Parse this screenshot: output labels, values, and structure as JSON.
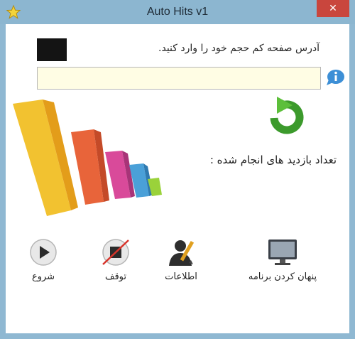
{
  "window": {
    "title": "Auto Hits v1",
    "close_label": "✕"
  },
  "form": {
    "url_label": "آدرس صفحه کم حجم خود را وارد کنید.",
    "url_value": "",
    "visits_label": "تعداد بازدید های انجام شده :"
  },
  "actions": {
    "start": "شروع",
    "stop": "توقف",
    "info": "اطلاعات",
    "hide": "پنهان کردن برنامه"
  },
  "colors": {
    "titlebar": "#8cb6d0",
    "close": "#c9463d",
    "swatch": "#141414",
    "input_bg": "#fffde4",
    "refresh": "#3c9a2c"
  },
  "icons": [
    "star-icon",
    "close-icon",
    "info-icon",
    "refresh-icon",
    "play-icon",
    "stop-icon",
    "user-pen-icon",
    "monitor-icon"
  ]
}
